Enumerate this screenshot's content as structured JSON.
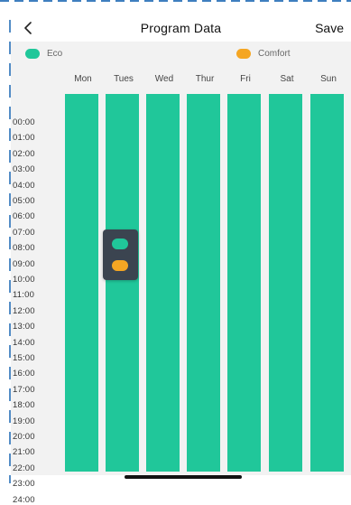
{
  "header": {
    "back_icon": "chevron-left-icon",
    "title": "Program Data",
    "save_label": "Save"
  },
  "legend": {
    "eco": {
      "label": "Eco",
      "color": "#20c79a"
    },
    "comfort": {
      "label": "Comfort",
      "color": "#f5a623"
    }
  },
  "days": [
    "Mon",
    "Tues",
    "Wed",
    "Thur",
    "Fri",
    "Sat",
    "Sun"
  ],
  "times": [
    "00:00",
    "01:00",
    "02:00",
    "03:00",
    "04:00",
    "05:00",
    "06:00",
    "07:00",
    "08:00",
    "09:00",
    "10:00",
    "11:00",
    "12:00",
    "13:00",
    "14:00",
    "15:00",
    "16:00",
    "17:00",
    "18:00",
    "19:00",
    "20:00",
    "21:00",
    "22:00",
    "23:00",
    "24:00"
  ],
  "schedule_mode": "Eco",
  "colors": {
    "eco": "#20c79a",
    "comfort": "#f5a623",
    "picker_background": "#3b4450",
    "panel_background": "#f2f2f2"
  }
}
